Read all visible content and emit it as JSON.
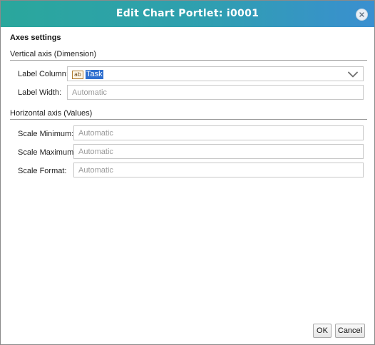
{
  "dialog": {
    "title": "Edit Chart Portlet: i0001",
    "close_icon": "close-icon"
  },
  "axes": {
    "section_title": "Axes settings",
    "vertical": {
      "header": "Vertical axis (Dimension)",
      "label_column": {
        "label": "Label Column:",
        "value": "Task",
        "type_icon": "ab",
        "dropdown_icon": "chevron-down-icon"
      },
      "label_width": {
        "label": "Label Width:",
        "placeholder": "Automatic"
      }
    },
    "horizontal": {
      "header": "Horizontal axis (Values)",
      "scale_minimum": {
        "label": "Scale Minimum:",
        "placeholder": "Automatic"
      },
      "scale_maximum": {
        "label": "Scale Maximum:",
        "placeholder": "Automatic"
      },
      "scale_format": {
        "label": "Scale Format:",
        "placeholder": "Automatic"
      }
    }
  },
  "buttons": {
    "ok": "OK",
    "cancel": "Cancel"
  }
}
